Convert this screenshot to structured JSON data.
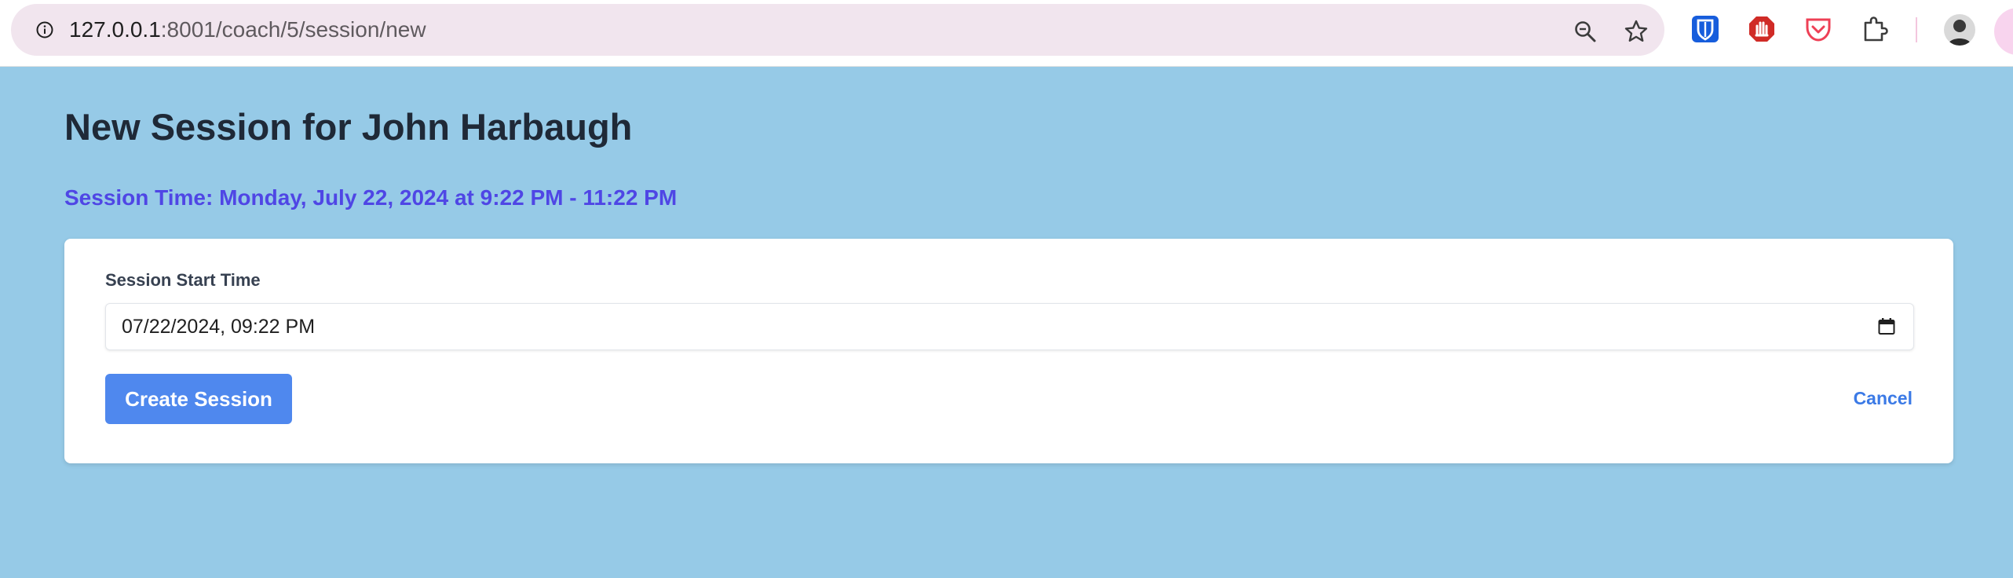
{
  "browser": {
    "url_host": "127.0.0.1",
    "url_rest": ":8001/coach/5/session/new",
    "icons": [
      "info-icon",
      "zoom-icon",
      "star-icon",
      "bitwarden-icon",
      "ublock-icon",
      "pocket-icon",
      "extensions-icon",
      "avatar"
    ]
  },
  "page": {
    "title": "New Session for John Harbaugh",
    "session_time": "Session Time: Monday, July 22, 2024 at 9:22 PM - 11:22 PM"
  },
  "form": {
    "start_label": "Session Start Time",
    "start_value": "07/22/2024, 09:22 PM",
    "submit_label": "Create Session",
    "cancel_label": "Cancel"
  },
  "colors": {
    "page_background": "#96cae7",
    "title": "#1f2937",
    "session_time": "#4f46e5",
    "primary_button": "#4f88ee",
    "cancel_link": "#3b7ae6"
  }
}
